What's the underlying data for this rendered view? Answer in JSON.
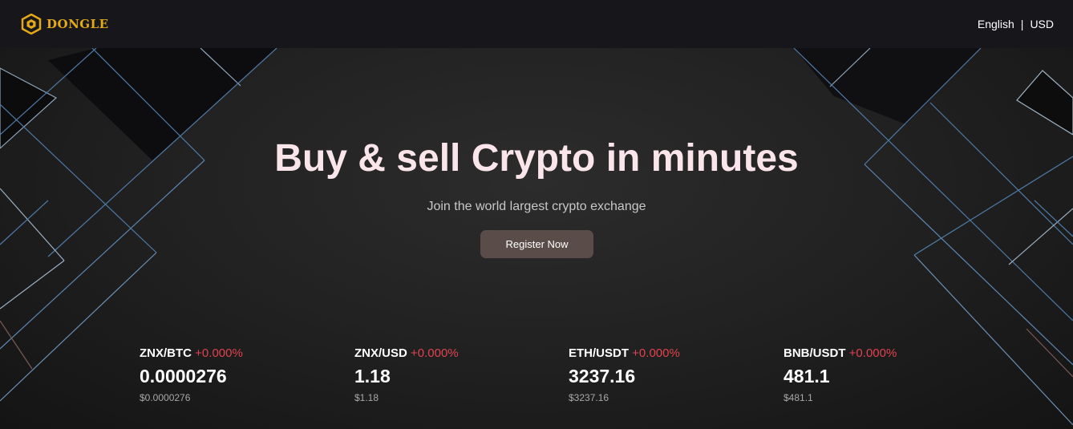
{
  "brand": {
    "name": "DONGLE",
    "color": "#e3a917"
  },
  "nav": {
    "language": "English",
    "separator": "|",
    "currency": "USD"
  },
  "hero": {
    "title": "Buy & sell Crypto in minutes",
    "subtitle": "Join the world largest crypto exchange",
    "cta_label": "Register Now"
  },
  "tickers": [
    {
      "pair": "ZNX/BTC",
      "change": "+0.000%",
      "price": "0.0000276",
      "usd": "$0.0000276"
    },
    {
      "pair": "ZNX/USD",
      "change": "+0.000%",
      "price": "1.18",
      "usd": "$1.18"
    },
    {
      "pair": "ETH/USDT",
      "change": "+0.000%",
      "price": "3237.16",
      "usd": "$3237.16"
    },
    {
      "pair": "BNB/USDT",
      "change": "+0.000%",
      "price": "481.1",
      "usd": "$481.1"
    }
  ],
  "colors": {
    "change_negative": "#e0434f",
    "cta_bg": "#5a4d49",
    "title": "#fae6ea"
  }
}
